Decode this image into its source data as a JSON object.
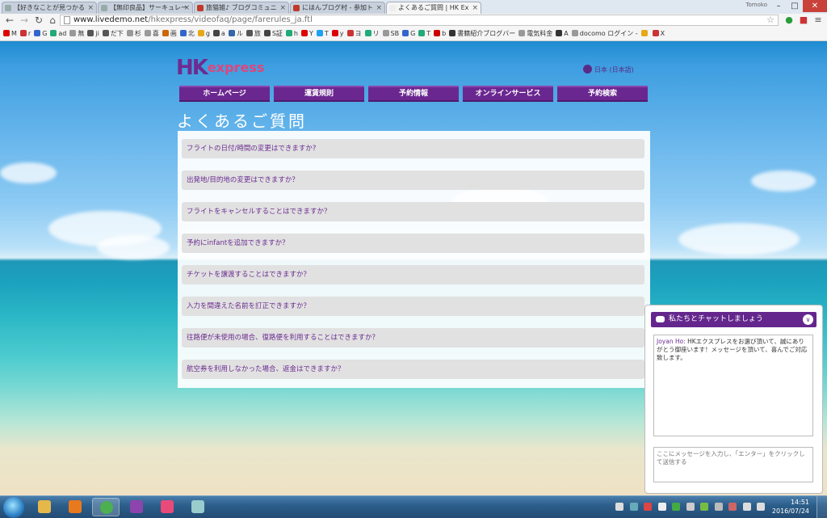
{
  "browser": {
    "tabs": [
      {
        "title": "【好きなことが見つかる",
        "color": "#9aa"
      },
      {
        "title": "【無印良品】サーキュレー",
        "color": "#9aa"
      },
      {
        "title": "旅猫雑♪ ブログコミュニ",
        "color": "#c0392b"
      },
      {
        "title": "にほんブログ村 - 参加ト",
        "color": "#c0392b"
      },
      {
        "title": "よくあるご質問 | HK Ex",
        "color": "#eee"
      }
    ],
    "window_user": "Tomoko",
    "url_host": "www.livedemo.net",
    "url_path": "/hkexpress/videofaq/page/farerules_ja.ftl",
    "bookmarks": [
      {
        "label": "M",
        "color": "#d00"
      },
      {
        "label": "r",
        "color": "#c33"
      },
      {
        "label": "G",
        "color": "#36c"
      },
      {
        "label": "ad",
        "color": "#2a7"
      },
      {
        "label": "無",
        "color": "#999"
      },
      {
        "label": "ji",
        "color": "#555"
      },
      {
        "label": "だ下",
        "color": "#555"
      },
      {
        "label": "杉",
        "color": "#999"
      },
      {
        "label": "喜",
        "color": "#999"
      },
      {
        "label": "画",
        "color": "#c60"
      },
      {
        "label": "北",
        "color": "#36c"
      },
      {
        "label": "g",
        "color": "#e6a817"
      },
      {
        "label": "a",
        "color": "#444"
      },
      {
        "label": "ル",
        "color": "#36a"
      },
      {
        "label": "旅",
        "color": "#555"
      },
      {
        "label": "S証",
        "color": "#444"
      },
      {
        "label": "h",
        "color": "#2a7"
      },
      {
        "label": "Y",
        "color": "#d00"
      },
      {
        "label": "T",
        "color": "#1da1f2"
      },
      {
        "label": "y",
        "color": "#d00"
      },
      {
        "label": "ヨ",
        "color": "#c33"
      },
      {
        "label": "リ",
        "color": "#2a7"
      },
      {
        "label": "SB",
        "color": "#999"
      },
      {
        "label": "G",
        "color": "#36c"
      },
      {
        "label": "T",
        "color": "#2a7"
      },
      {
        "label": "b",
        "color": "#c00"
      },
      {
        "label": "書籍紹介ブログバー",
        "color": "#333"
      },
      {
        "label": "電気料金",
        "color": "#999"
      },
      {
        "label": "A",
        "color": "#333"
      },
      {
        "label": "docomo ログイン -",
        "color": "#999"
      },
      {
        "label": "",
        "color": "#e6a817"
      },
      {
        "label": "X",
        "color": "#c33"
      }
    ]
  },
  "site": {
    "logo_hk": "HK",
    "logo_express": "express",
    "language": "日本 (日本語)",
    "nav": [
      "ホームページ",
      "運賃規則",
      "予約情報",
      "オンラインサービス",
      "予約検索"
    ],
    "page_title": "よくあるご質問",
    "faqs": [
      "フライトの日付/時間の変更はできますか?",
      "出発地/目的地の変更はできますか？",
      "フライトをキャンセルすることはできますか？",
      "予約にinfantを追加できますか？",
      "チケットを譲渡することはできますか？",
      "入力を間違えた名前を訂正できますか？",
      "往路便が未使用の場合、復路便を利用することはできますか？",
      "航空券を利用しなかった場合、返金はできますか？"
    ]
  },
  "chat": {
    "header": "私たちとチャットしましょう",
    "agent_name": "Joyan Ho:",
    "message": "HKエクスプレスをお選び頂いて、誠にありがとう御座います！メッセージを頂いて、喜んでご対応致します。",
    "input_placeholder": "ここにメッセージを入力し、「エンター」をクリックして送信する"
  },
  "taskbar": {
    "time": "14:51",
    "date": "2016/07/24",
    "apps": [
      {
        "name": "explorer",
        "color": "#e6b84a"
      },
      {
        "name": "media-player",
        "color": "#e87a1d"
      },
      {
        "name": "chrome",
        "color": "#4caf50"
      },
      {
        "name": "app",
        "color": "#8e44ad"
      },
      {
        "name": "itunes",
        "color": "#e84a7a"
      },
      {
        "name": "paint",
        "color": "#9cc"
      }
    ]
  }
}
